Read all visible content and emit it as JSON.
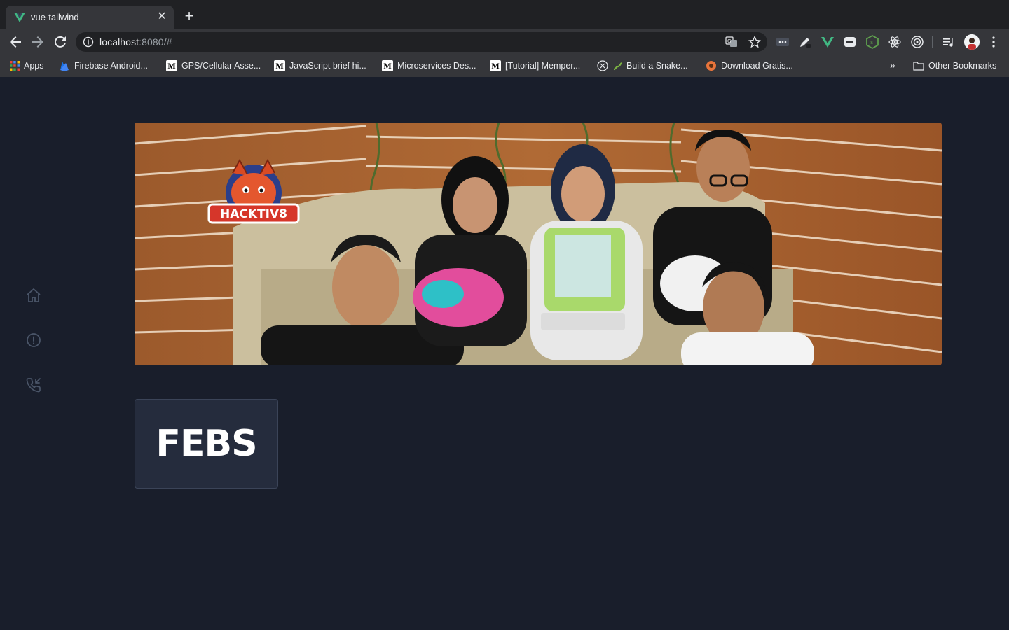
{
  "browser": {
    "tab_title": "vue-tailwind",
    "url_host": "localhost",
    "url_rest": ":8080/#",
    "bookmarks": [
      "Apps",
      "Firebase Android...",
      "GPS/Cellular Asse...",
      "JavaScript brief hi...",
      "Microservices Des...",
      "[Tutorial] Memper...",
      "Build a Snake...",
      "Download Gratis..."
    ],
    "other_bookmarks": "Other Bookmarks",
    "more_bookmarks": "»"
  },
  "sidebar": {
    "icons": [
      "home-icon",
      "alert-circle-icon",
      "phone-incoming-icon"
    ]
  },
  "hero": {
    "logo_text": "HACKTIV8"
  },
  "card": {
    "label": "FEBS"
  },
  "colors": {
    "page_bg": "#191e2b",
    "card_bg": "#252c3d",
    "vue_green": "#41b883"
  }
}
